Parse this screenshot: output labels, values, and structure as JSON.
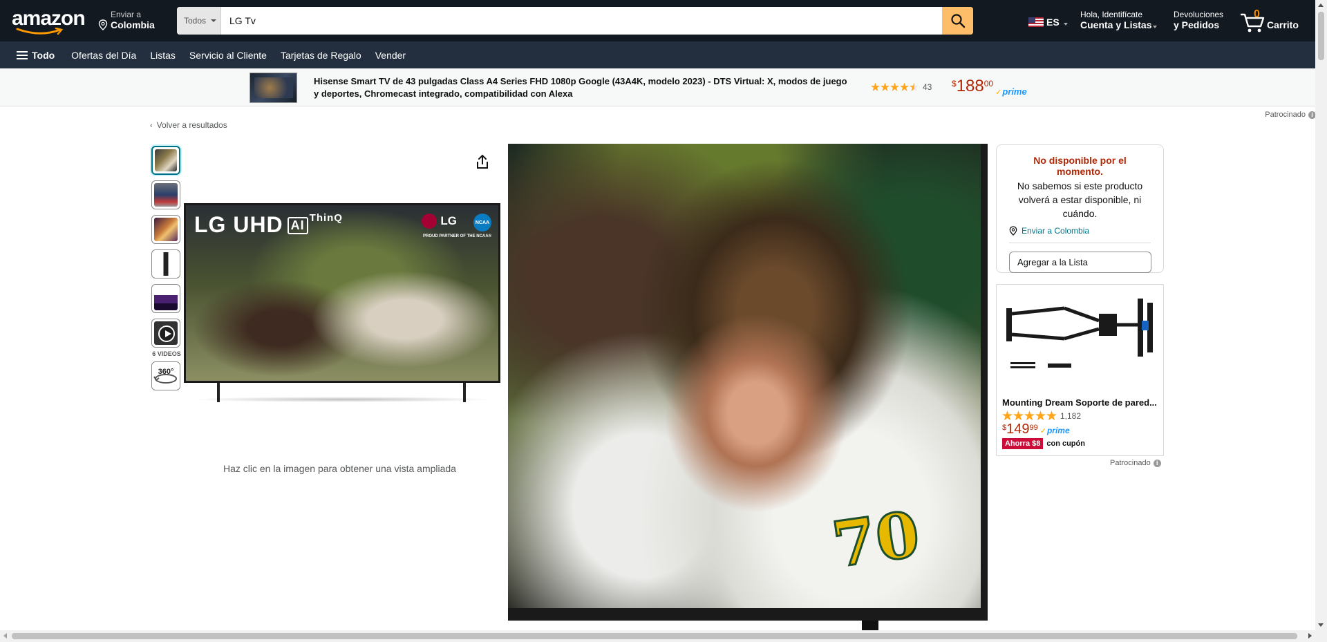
{
  "header": {
    "logo": "amazon",
    "deliver_line1": "Enviar a",
    "deliver_line2": "Colombia",
    "search_category": "Todos",
    "search_value": "LG Tv",
    "language": "ES",
    "account_line1": "Hola, Identifícate",
    "account_line2": "Cuenta y Listas",
    "returns_line1": "Devoluciones",
    "returns_line2": "y Pedidos",
    "cart_count": "0",
    "cart_label": "Carrito"
  },
  "subnav": {
    "all_label": "Todo",
    "items": [
      "Ofertas del Día",
      "Listas",
      "Servicio al Cliente",
      "Tarjetas de Regalo",
      "Vender"
    ]
  },
  "sponsored_strip": {
    "title": "Hisense Smart TV de 43 pulgadas Class A4 Series FHD 1080p Google (43A4K, modelo 2023) - DTS Virtual: X, modos de juego y deportes, Chromecast integrado, compatibilidad con Alexa",
    "rating_stars": 4.5,
    "rating_count": "43",
    "price_currency": "$",
    "price_whole": "188",
    "price_fraction": "00",
    "prime": "prime"
  },
  "sponsored_label": "Patrocinado",
  "breadcrumb": {
    "back": "Volver a resultados"
  },
  "gallery": {
    "videos_label": "6 VIDEOS",
    "spin_label": "360°",
    "zoom_hint": "Haz clic en la imagen para obtener una vista ampliada",
    "tv_title": "LG UHD",
    "tv_ai": "AI",
    "tv_thinq": "ThinQ",
    "tv_brand": "LG",
    "tv_ncaa": "NCAA",
    "tv_partner": "PROUD PARTNER OF THE NCAA®",
    "jersey_number": "70"
  },
  "buybox": {
    "unavailable_title": "No disponible por el momento.",
    "unavailable_msg": "No sabemos si este producto volverá a estar disponible, ni cuándo.",
    "ship_to": "Enviar a Colombia",
    "add_to_list": "Agregar a la Lista"
  },
  "ad": {
    "title": "Mounting Dream Soporte de pared...",
    "rating_stars": 5,
    "rating_count": "1,182",
    "price_currency": "$",
    "price_whole": "149",
    "price_fraction": "99",
    "prime": "prime",
    "coupon_badge": "Ahorra $8",
    "coupon_text": "con cupón",
    "sponsored": "Patrocinado"
  },
  "colors": {
    "nav_top": "#131921",
    "nav_sub": "#232f3e",
    "search_button": "#febd69",
    "price": "#b12704",
    "link": "#007185",
    "star": "#ffa41c",
    "coupon": "#cc0c39"
  }
}
